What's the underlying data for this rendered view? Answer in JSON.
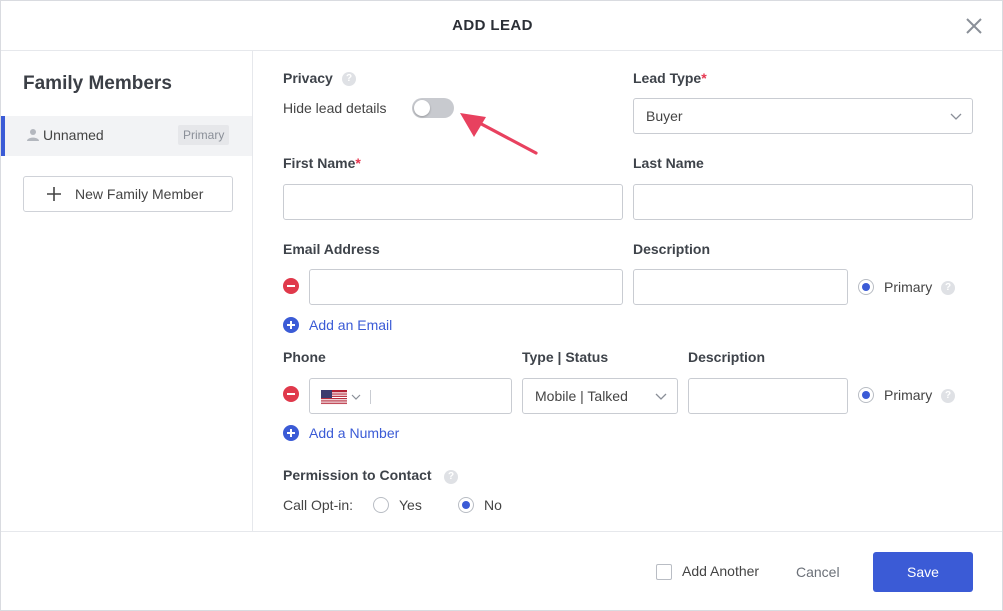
{
  "header": {
    "title": "ADD LEAD",
    "close_icon": "close-icon"
  },
  "sidebar": {
    "title": "Family Members",
    "members": [
      {
        "name": "Unnamed",
        "badge": "Primary"
      }
    ],
    "new_member_label": "New Family Member"
  },
  "form": {
    "privacy": {
      "label": "Privacy",
      "toggle_label": "Hide lead details",
      "enabled": false
    },
    "lead_type": {
      "label": "Lead Type",
      "required_mark": "*",
      "value": "Buyer"
    },
    "first_name": {
      "label": "First Name",
      "required_mark": "*",
      "value": ""
    },
    "last_name": {
      "label": "Last Name",
      "value": ""
    },
    "email": {
      "label": "Email Address",
      "description_label": "Description",
      "value": "",
      "description_value": "",
      "primary_label": "Primary",
      "add_label": "Add an Email"
    },
    "phone": {
      "label": "Phone",
      "type_status_label": "Type | Status",
      "description_label": "Description",
      "country_icon": "us-flag-icon",
      "value": "",
      "type_status_value": "Mobile | Talked",
      "description_value": "",
      "primary_label": "Primary",
      "add_label": "Add a Number"
    },
    "permission": {
      "label": "Permission to Contact",
      "call_opt_in_label": "Call Opt-in:",
      "yes_label": "Yes",
      "no_label": "No",
      "selected": "No"
    }
  },
  "footer": {
    "add_another_label": "Add Another",
    "cancel_label": "Cancel",
    "save_label": "Save"
  },
  "colors": {
    "accent": "#3b5bd6",
    "danger": "#e0394b",
    "required": "#e5364f",
    "annotation_arrow": "#e8415f"
  }
}
